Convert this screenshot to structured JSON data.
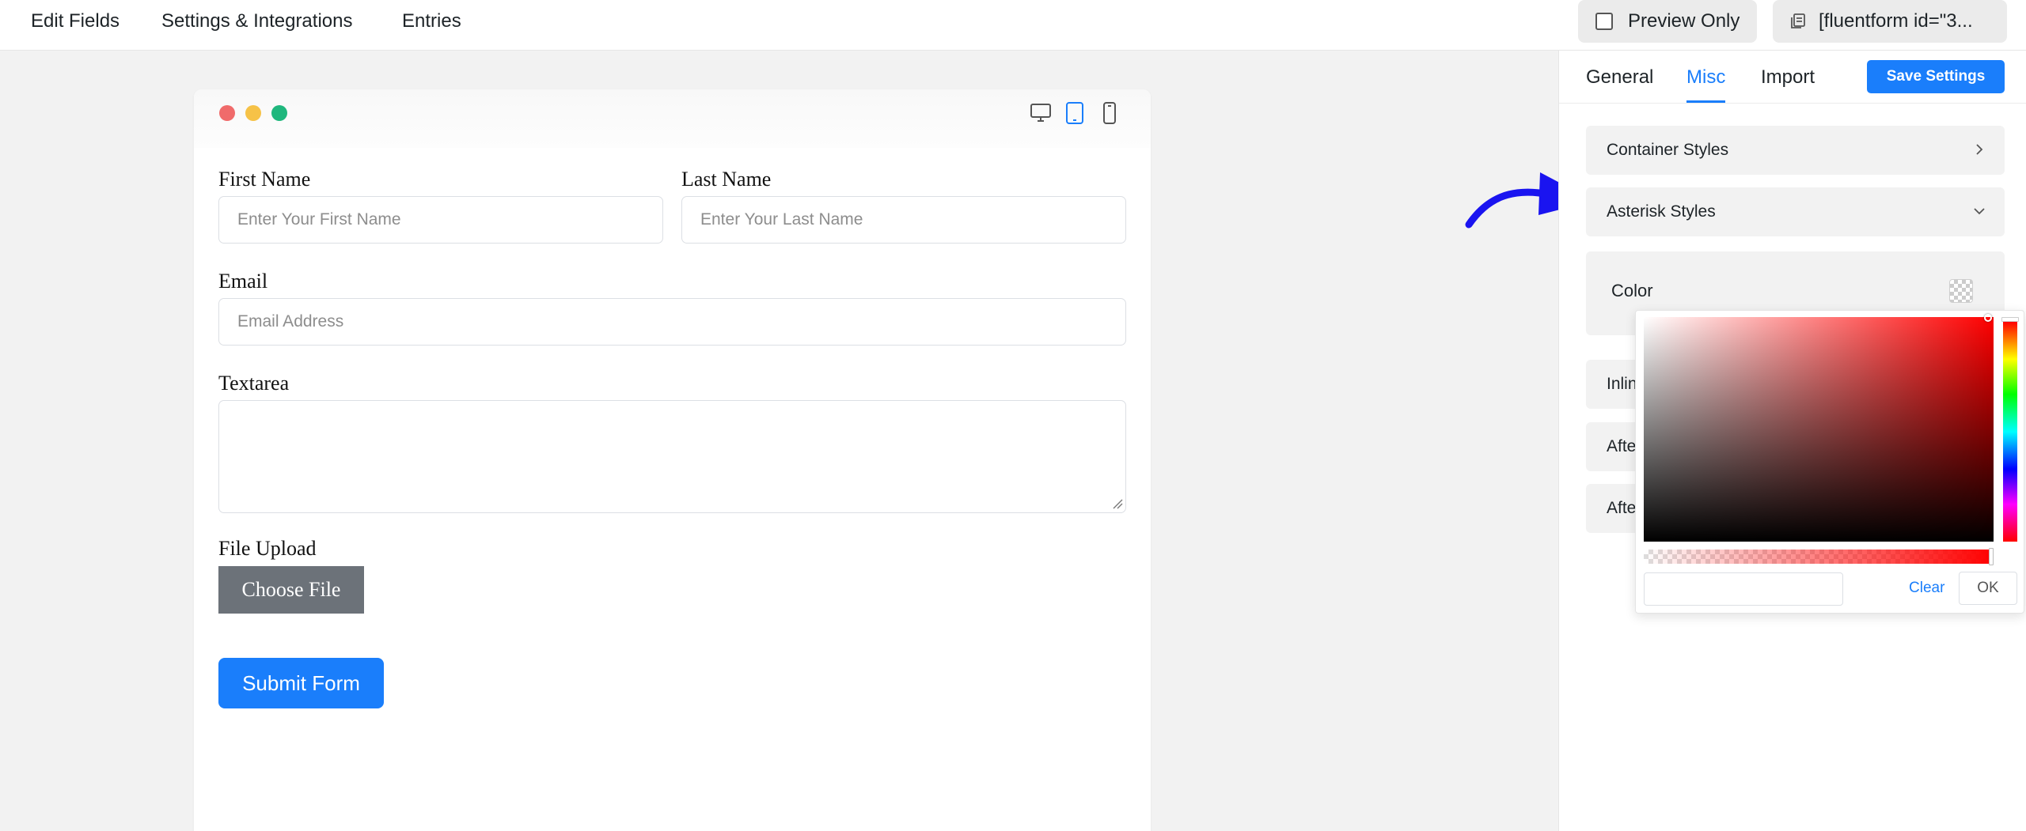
{
  "topbar": {
    "nav": [
      "Edit Fields",
      "Settings & Integrations",
      "Entries"
    ],
    "preview_label": "Preview Only",
    "shortcode_label": "[fluentform id=\"3..."
  },
  "form": {
    "first_name_label": "First Name",
    "first_name_placeholder": "Enter Your First Name",
    "last_name_label": "Last Name",
    "last_name_placeholder": "Enter Your Last Name",
    "email_label": "Email",
    "email_placeholder": "Email Address",
    "textarea_label": "Textarea",
    "file_upload_label": "File Upload",
    "choose_file_label": "Choose File",
    "submit_label": "Submit Form"
  },
  "panel": {
    "tabs": [
      "General",
      "Misc",
      "Import"
    ],
    "active_tab": "Misc",
    "save_label": "Save Settings",
    "sections": {
      "container_styles": "Container Styles",
      "asterisk_styles": "Asterisk Styles",
      "color_label": "Color",
      "inline": "Inline",
      "after_1": "After",
      "after_2": "After"
    }
  },
  "picker": {
    "hue_color": "#ff0000",
    "hex_value": "",
    "clear_label": "Clear",
    "ok_label": "OK"
  },
  "colors": {
    "accent": "#1a7efb",
    "arrow": "#1a14f0",
    "choose_button": "#6c7279"
  },
  "icons": {
    "copy": "copy-icon",
    "desktop": "desktop-icon",
    "tablet": "tablet-icon",
    "mobile": "mobile-icon",
    "chevron_right": "chevron-right-icon",
    "chevron_down": "chevron-down-icon"
  }
}
